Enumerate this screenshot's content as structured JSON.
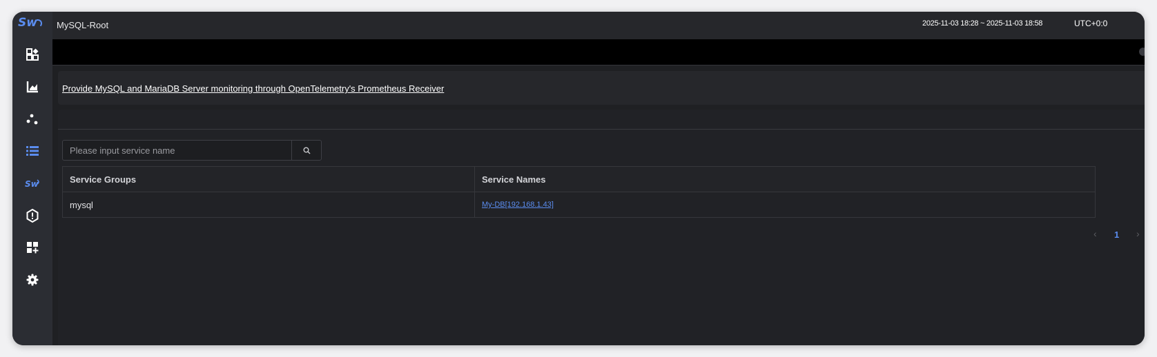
{
  "app": {
    "logo_text": "Sw",
    "title": "MySQL-Root",
    "time_range": "2025-11-03 18:28 ~ 2025-11-03 18:58",
    "timezone": "UTC+0:0",
    "dark_mode": true,
    "accent_color": "#5b8df0"
  },
  "sidebar": {
    "items": [
      {
        "icon": "dashboard-icon",
        "active": false
      },
      {
        "icon": "chart-icon",
        "active": false
      },
      {
        "icon": "topology-icon",
        "active": false
      },
      {
        "icon": "list-icon",
        "active": true
      },
      {
        "icon": "skywalking-logo-icon",
        "active": false
      },
      {
        "icon": "alert-icon",
        "active": false
      },
      {
        "icon": "add-widget-icon",
        "active": false
      },
      {
        "icon": "settings-icon",
        "active": false
      }
    ]
  },
  "description": {
    "text": "Provide MySQL and MariaDB Server monitoring through OpenTelemetry's Prometheus Receiver"
  },
  "search": {
    "placeholder": "Please input service name",
    "value": ""
  },
  "table": {
    "headers": [
      "Service Groups",
      "Service Names"
    ],
    "rows": [
      {
        "group": "mysql",
        "name": "My-DB[192.168.1.43]"
      }
    ]
  },
  "pagination": {
    "current_page": "1",
    "prev": "‹",
    "next": "›"
  }
}
